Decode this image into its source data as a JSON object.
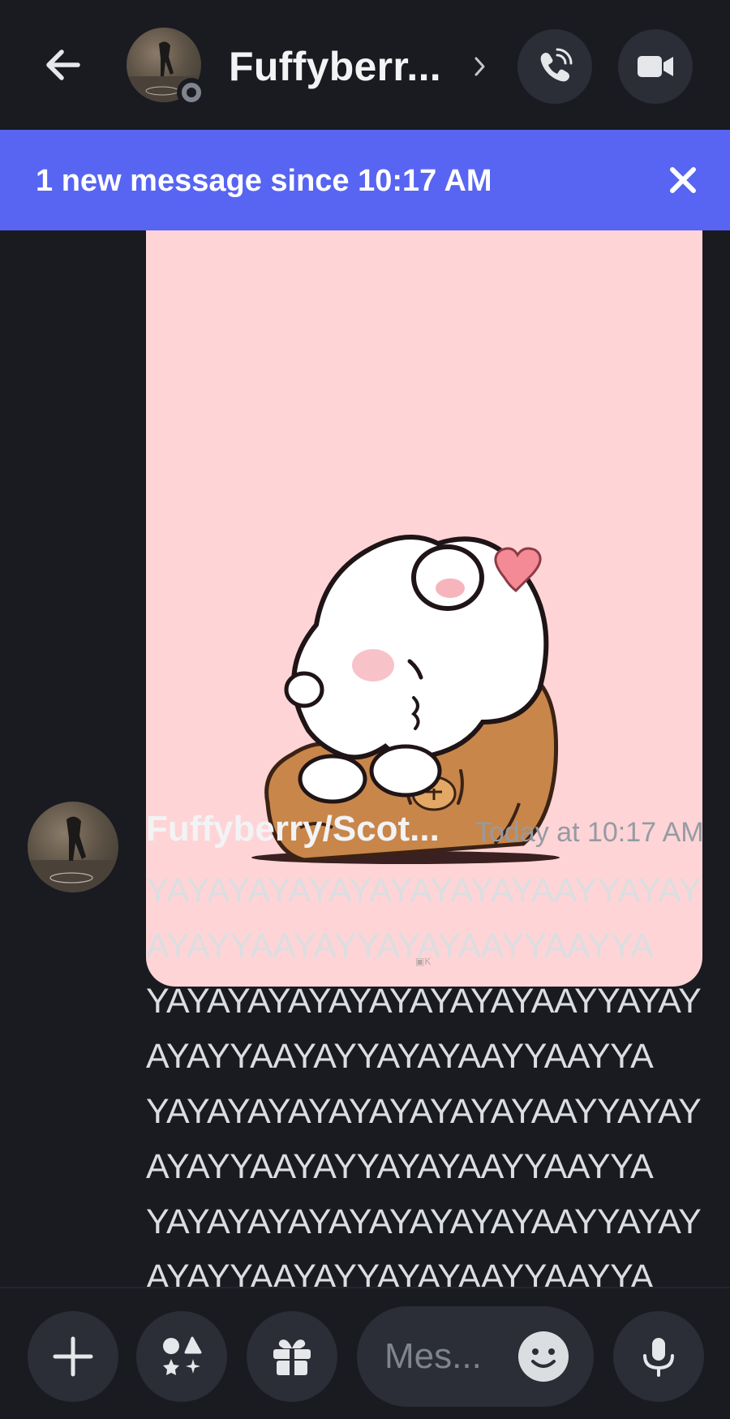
{
  "header": {
    "name": "Fuffyberr...",
    "chevron": "›",
    "icons": {
      "back": "arrow-left-icon",
      "call": "phone-icon",
      "video": "video-camera-icon"
    }
  },
  "banner": {
    "text": "1 new message since 10:17 AM",
    "close_icon": "close-icon"
  },
  "message": {
    "author": "Fuffyberry/Scot...",
    "timestamp": "Today at 10:17 AM",
    "lines": [
      "YAYAYAYAYAYAYAYAYAYAAYYAYAY",
      "AYAYYAAYAYYAYAYAAYYAAYYA",
      "YAYAYAYAYAYAYAYAYAYAAYYAYAY",
      "AYAYYAAYAYYAYAYAAYYAAYYA",
      "YAYAYAYAYAYAYAYAYAYAAYYAYAY",
      "AYAYYAAYAYYAYAYAAYYAAYYA",
      "YAYAYAYAYAYAYAYAYAYAAYYAYAY",
      "AYAYYAAYAYYAYAYAAYYAAYYA"
    ]
  },
  "composer": {
    "placeholder": "Mes...",
    "icons": {
      "plus": "plus-icon",
      "apps": "apps-icon",
      "gift": "gift-icon",
      "emoji": "smiley-icon",
      "mic": "microphone-icon"
    }
  },
  "colors": {
    "background": "#1a1b21",
    "banner": "#5865f2",
    "button_bg": "#2b2d37",
    "sticker_bg": "#ffd4d6"
  }
}
